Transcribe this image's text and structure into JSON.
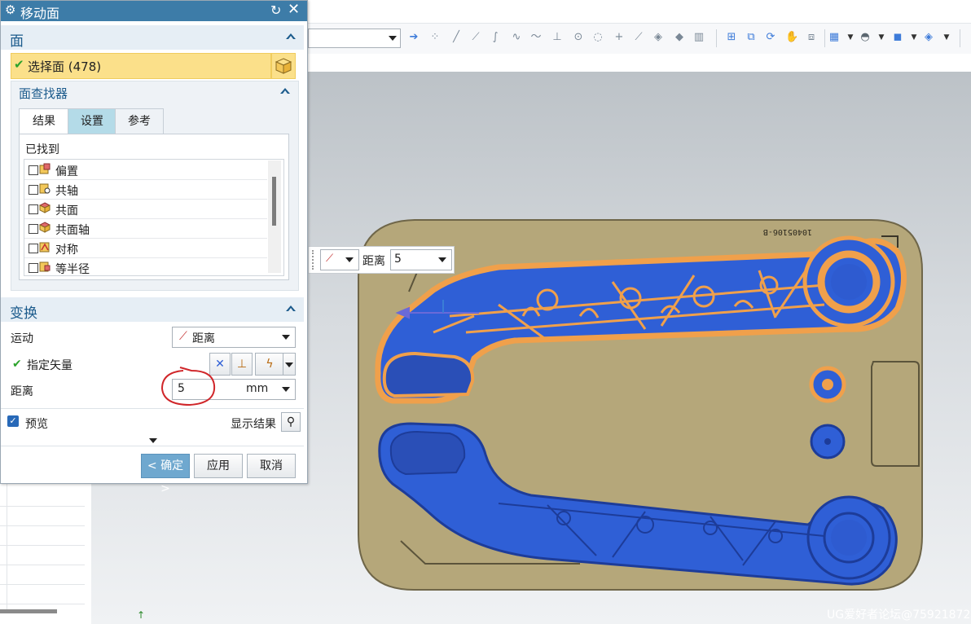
{
  "dialog": {
    "title": "移动面",
    "face_section": {
      "heading": "面",
      "select_faces": "选择面 (478)"
    },
    "face_finder": {
      "heading": "面查找器",
      "tabs": [
        "结果",
        "设置",
        "参考"
      ],
      "found_label": "已找到",
      "items": [
        "偏置",
        "共轴",
        "共面",
        "共面轴",
        "对称",
        "等半径"
      ]
    },
    "transform": {
      "heading": "变换",
      "motion_label": "运动",
      "motion_value": "距离",
      "vector_label": "指定矢量",
      "distance_label": "距离",
      "distance_value": "5",
      "distance_unit": "mm"
    },
    "preview": {
      "label": "预览",
      "show_result": "显示结果"
    },
    "buttons": {
      "ok": "< 确定 >",
      "apply": "应用",
      "cancel": "取消"
    }
  },
  "viewport": {
    "hint_distance_label": "距离",
    "hint_distance_value": "5",
    "engraved_text": "10405106-B",
    "watermark": "UG爱好者论坛@75921872"
  },
  "colors": {
    "title_bar": "#3d7ca8",
    "section_text": "#1c5b8c",
    "selection_highlight": "#fbe08a",
    "part_blue": "#2f5fd6",
    "selected_orange": "#f0a04b",
    "mold_plate": "#b5a77a",
    "annotation_circle": "#d0262a"
  }
}
